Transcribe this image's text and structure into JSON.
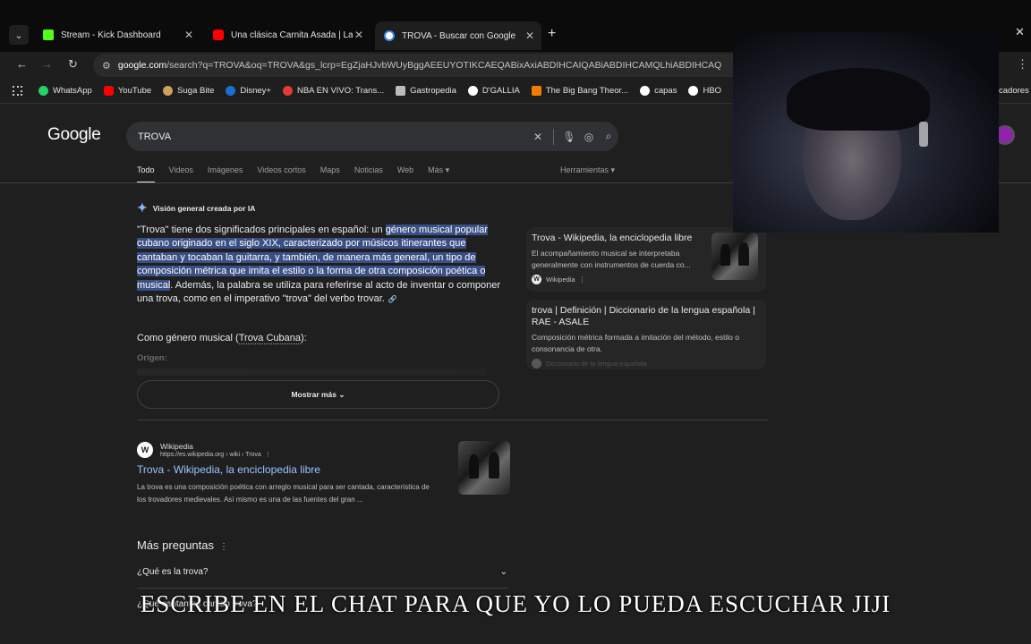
{
  "tabs": [
    {
      "title": "Stream - Kick Dashboard",
      "favicon_color": "#53fc18"
    },
    {
      "title": "Una clásica Carnita Asada | La C",
      "favicon_color": "#ff0000"
    },
    {
      "title": "TROVA - Buscar con Google",
      "favicon_color": "#4285f4"
    }
  ],
  "toolbar": {
    "url_domain": "google.com",
    "url_rest": "/search?q=TROVA&oq=TROVA&gs_lcrp=EgZjaHJvbWUyBggAEEUYOTIKCAEQABixAxiABDIHCAIQABiABDIHCAMQLhiABDIHCAQ"
  },
  "bookmarks": [
    {
      "label": "WhatsApp",
      "color": "#25d366"
    },
    {
      "label": "YouTube",
      "color": "#ff0000"
    },
    {
      "label": "Suga Bite",
      "color": "#d0a060"
    },
    {
      "label": "Disney+",
      "color": "#1b6fd1"
    },
    {
      "label": "NBA EN VIVO: Trans...",
      "color": "#e53935"
    },
    {
      "label": "Gastropedia",
      "color": "#bbbbbb"
    },
    {
      "label": "D'GALLIA",
      "color": "#ffffff"
    },
    {
      "label": "The Big Bang Theor...",
      "color": "#f57c00"
    },
    {
      "label": "capas",
      "color": "#ffffff"
    },
    {
      "label": "HBO",
      "color": "#ffffff"
    }
  ],
  "bookmarks_cut_label": "cadores",
  "search": {
    "logo": "Google",
    "query": "TROVA",
    "nav_tabs": [
      "Todo",
      "Videos",
      "Imágenes",
      "Videos cortos",
      "Maps",
      "Noticias",
      "Web",
      "Más ▾"
    ],
    "tools": "Herramientas ▾"
  },
  "ai_overview": {
    "header": "Visión general creada por IA",
    "p_start": "\"Trova\" tiene dos significados principales en español: un ",
    "p_highlight": "género musical popular cubano originado en el siglo XIX, caracterizado por músicos itinerantes que cantaban y tocaban la guitarra, y también, de manera más general, un tipo de composición métrica que imita el estilo o la forma de otra composición poética o musical",
    "p_end": ". Además, la palabra se utiliza para referirse al acto de inventar o componer una trova, como en el imperativo \"trova\" del verbo trovar.",
    "sub_prefix": "Como género musical (",
    "sub_link": "Trova Cubana",
    "sub_suffix": "):",
    "origin": "Origen:",
    "more_button": "Mostrar más"
  },
  "sources": [
    {
      "title": "Trova - Wikipedia, la enciclopedia libre",
      "desc": "El acompañamiento musical se interpretaba generalmente con instrumentos de cuerda co...",
      "site": "Wikipedia"
    },
    {
      "title": "trova | Definición | Diccionario de la lengua española | RAE - ASALE",
      "desc": "Composición métrica formada a imitación del método, estilo o consonancia de otra.",
      "site": "Diccionario de la lengua española"
    }
  ],
  "result": {
    "site_name": "Wikipedia",
    "url": "https://es.wikipedia.org › wiki › Trova",
    "title": "Trova - Wikipedia, la enciclopedia libre",
    "snippet": "La trova es una composición poética con arreglo musical para ser cantada, característica de los trovadores medievales. Así mismo es una de las fuentes del gran ..."
  },
  "paa": {
    "heading": "Más preguntas",
    "q1": "¿Qué es la trova?",
    "q2": "¿Qué cantantes cantan trova?"
  },
  "caption": "ESCRIBE EN EL CHAT PARA QUE YO LO PUEDA ESCUCHAR JIJI"
}
